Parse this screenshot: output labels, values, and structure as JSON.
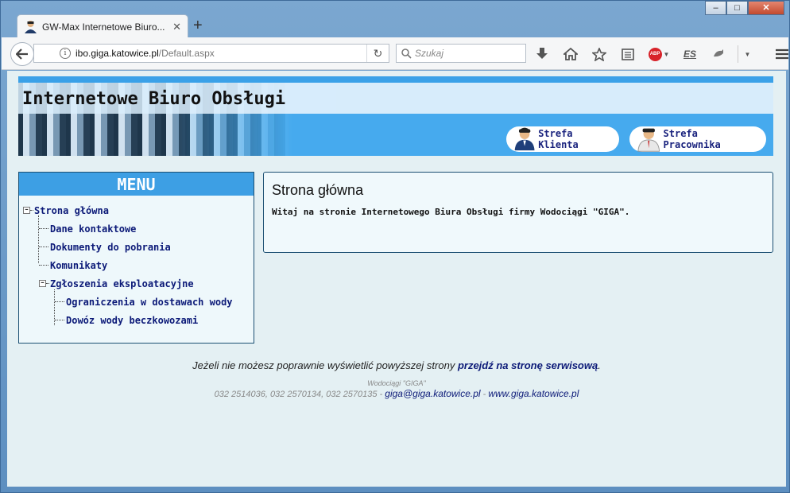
{
  "browser": {
    "tab_title": "GW-Max Internetowe Biuro...",
    "url_domain": "ibo.giga.katowice.pl",
    "url_path": "/Default.aspx",
    "search_placeholder": "Szukaj",
    "icons": [
      "download-icon",
      "home-icon",
      "bookmark-star-icon",
      "reader-icon",
      "adblock-icon",
      "es-icon",
      "extension-icon",
      "menu-icon"
    ],
    "abp_label": "ABP",
    "es_label": "ES"
  },
  "header": {
    "title": "Internetowe Biuro Obsługi",
    "zone_client": "Strefa Klienta",
    "zone_employee": "Strefa Pracownika"
  },
  "menu": {
    "title": "MENU",
    "items": [
      {
        "label": "Strona główna"
      },
      {
        "label": "Dane kontaktowe"
      },
      {
        "label": "Dokumenty do pobrania"
      },
      {
        "label": "Komunikaty"
      },
      {
        "label": "Zgłoszenia eksploatacyjne"
      },
      {
        "label": "Ograniczenia w dostawach wody"
      },
      {
        "label": "Dowóz wody beczkowozami"
      }
    ]
  },
  "content": {
    "heading": "Strona główna",
    "welcome": "Witaj na stronie Internetowego Biura Obsługi firmy Wodociągi \"GIGA\"."
  },
  "footer": {
    "notice": "Jeżeli nie możesz poprawnie wyświetlić powyższej strony ",
    "link": "przejdź na stronę serwisową",
    "notice_end": ".",
    "company": "Wodociągi \"GIGA\"",
    "phones": "032 2514036, 032 2570134, 032 2570135 - ",
    "email": "giga@giga.katowice.pl",
    "sep": " - ",
    "website": "www.giga.katowice.pl"
  },
  "colors": {
    "accent": "#3d9fe4",
    "link": "#0c1a78",
    "page_bg": "#e4f0f3"
  }
}
